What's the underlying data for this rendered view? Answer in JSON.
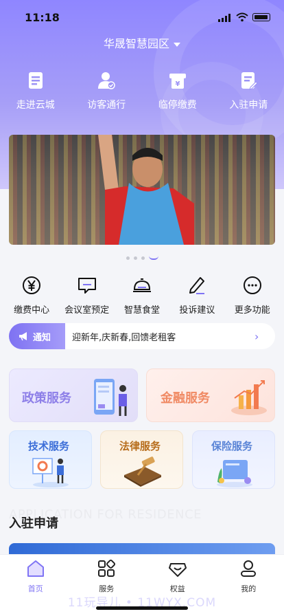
{
  "status": {
    "time": "11:18"
  },
  "header": {
    "park_name": "华晟智慧园区"
  },
  "quick_actions": [
    {
      "label": "走进云城",
      "icon": "document-icon"
    },
    {
      "label": "访客通行",
      "icon": "visitor-icon"
    },
    {
      "label": "临停缴费",
      "icon": "parking-fee-icon"
    },
    {
      "label": "入驻申请",
      "icon": "apply-icon"
    }
  ],
  "banner": {
    "slides": 4,
    "active_slide": 4
  },
  "services": [
    {
      "label": "缴费中心",
      "icon": "yen-icon"
    },
    {
      "label": "会议室预定",
      "icon": "meeting-room-icon"
    },
    {
      "label": "智慧食堂",
      "icon": "dining-bell-icon"
    },
    {
      "label": "投诉建议",
      "icon": "pencil-icon"
    },
    {
      "label": "更多功能",
      "icon": "more-icon"
    }
  ],
  "notice": {
    "tag": "通知",
    "text": "迎新年,庆新春,回馈老租客"
  },
  "service_cards": {
    "policy": "政策服务",
    "finance": "金融服务",
    "tech": "技术服务",
    "legal": "法律服务",
    "insurance": "保险服务"
  },
  "section": {
    "english": "APPLICATION FOR RESIDENCE",
    "title": "入驻申请"
  },
  "tabbar": [
    {
      "label": "首页",
      "icon": "home-icon",
      "active": true
    },
    {
      "label": "服务",
      "icon": "services-grid-icon",
      "active": false
    },
    {
      "label": "权益",
      "icon": "benefits-icon",
      "active": false
    },
    {
      "label": "我的",
      "icon": "profile-icon",
      "active": false
    }
  ],
  "watermark": "11玩导儿 • 11WYX.COM",
  "colors": {
    "accent": "#7f74f4",
    "hero_top": "#8f86ff",
    "finance": "#f08a64",
    "tech": "#3c6ed8",
    "legal": "#b76d1c"
  }
}
